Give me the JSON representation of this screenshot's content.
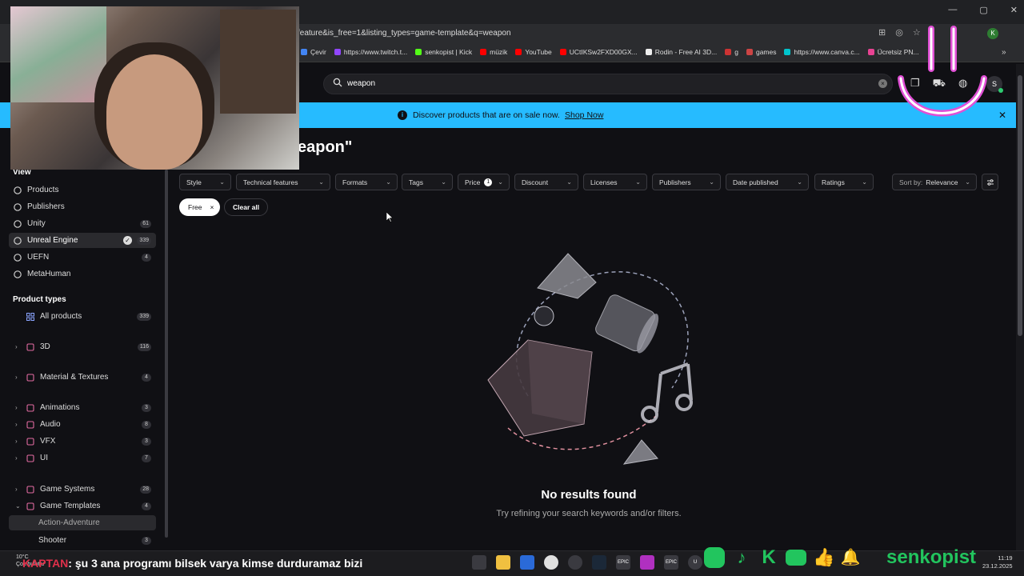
{
  "browser": {
    "url": "feature&is_free=1&listing_types=game-template&q=weapon",
    "window_controls": [
      "—",
      "▢",
      "✕"
    ],
    "profile_initial": "K",
    "bookmarks": [
      {
        "label": "Çevir",
        "color": "#4285f4"
      },
      {
        "label": "https://www.twitch.t...",
        "color": "#9146ff"
      },
      {
        "label": "senkopist | Kick",
        "color": "#53fc18"
      },
      {
        "label": "müzik",
        "color": "#ff0000"
      },
      {
        "label": "YouTube",
        "color": "#ff0000"
      },
      {
        "label": "UCtIKSw2FXD00GX...",
        "color": "#ff0000"
      },
      {
        "label": "Rodin - Free AI 3D...",
        "color": "#eeeeee"
      },
      {
        "label": "g",
        "color": "#cc3333"
      },
      {
        "label": "games",
        "color": "#cc4444"
      },
      {
        "label": "https://www.canva.c...",
        "color": "#00c4cc"
      },
      {
        "label": "Ücretsiz PN...",
        "color": "#e84393"
      }
    ],
    "bookmarks_more": "»"
  },
  "header": {
    "search_value": "weapon",
    "clear": "×",
    "avatar_initial": "S"
  },
  "banner": {
    "info": "i",
    "text": "Discover products that are on sale now.",
    "link": "Shop Now",
    "close": "✕"
  },
  "page_title": "eapon\"",
  "sidebar": {
    "view_heading": "View",
    "view_items": [
      {
        "label": "Products",
        "badge": ""
      },
      {
        "label": "Publishers",
        "badge": ""
      },
      {
        "label": "Unity",
        "badge": "61"
      },
      {
        "label": "Unreal Engine",
        "badge": "339"
      },
      {
        "label": "UEFN",
        "badge": "4"
      },
      {
        "label": "MetaHuman",
        "badge": ""
      }
    ],
    "types_heading": "Product types",
    "all_products": {
      "label": "All products",
      "badge": "339"
    },
    "categories": [
      {
        "label": "3D",
        "badge": "116"
      },
      {
        "label": "Material & Textures",
        "badge": "4"
      },
      {
        "label": "Animations",
        "badge": "3"
      },
      {
        "label": "Audio",
        "badge": "8"
      },
      {
        "label": "VFX",
        "badge": "3"
      },
      {
        "label": "UI",
        "badge": "7"
      },
      {
        "label": "Game Systems",
        "badge": "28"
      },
      {
        "label": "Game Templates",
        "badge": "4"
      }
    ],
    "subcategories": [
      {
        "label": "Action-Adventure",
        "badge": ""
      },
      {
        "label": "Shooter",
        "badge": "3"
      }
    ]
  },
  "filters": [
    {
      "label": "Style"
    },
    {
      "label": "Technical features"
    },
    {
      "label": "Formats"
    },
    {
      "label": "Tags"
    },
    {
      "label": "Price",
      "count": "1"
    },
    {
      "label": "Discount"
    },
    {
      "label": "Licenses"
    },
    {
      "label": "Publishers"
    },
    {
      "label": "Date published"
    },
    {
      "label": "Ratings"
    }
  ],
  "sort": {
    "prefix": "Sort by:",
    "value": "Relevance"
  },
  "active_filters": {
    "free": "Free",
    "remove": "×",
    "clear_all": "Clear all"
  },
  "empty_state": {
    "title": "No results found",
    "subtitle": "Try refining your search keywords and/or filters."
  },
  "taskbar": {
    "weather_temp": "10°C",
    "weather_desc": "Çok bulutlu",
    "ticker_name": "KAPTAN",
    "ticker_text": ": şu 3 ana programı bilsek varya kimse durduramaz bizi",
    "brand": "senkopist",
    "time": "11:19",
    "date": "23.12.2025",
    "apps": [
      "EPIC",
      "EPIC",
      "U"
    ]
  }
}
